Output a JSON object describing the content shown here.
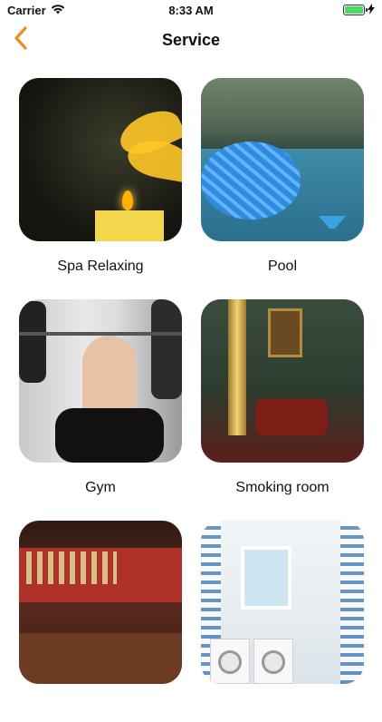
{
  "status": {
    "carrier": "Carrier",
    "time": "8:33 AM"
  },
  "nav": {
    "title": "Service",
    "accent": "#f08a24"
  },
  "services": [
    {
      "label": "Spa Relaxing"
    },
    {
      "label": "Pool"
    },
    {
      "label": "Gym"
    },
    {
      "label": "Smoking room"
    },
    {
      "label": ""
    },
    {
      "label": ""
    }
  ]
}
